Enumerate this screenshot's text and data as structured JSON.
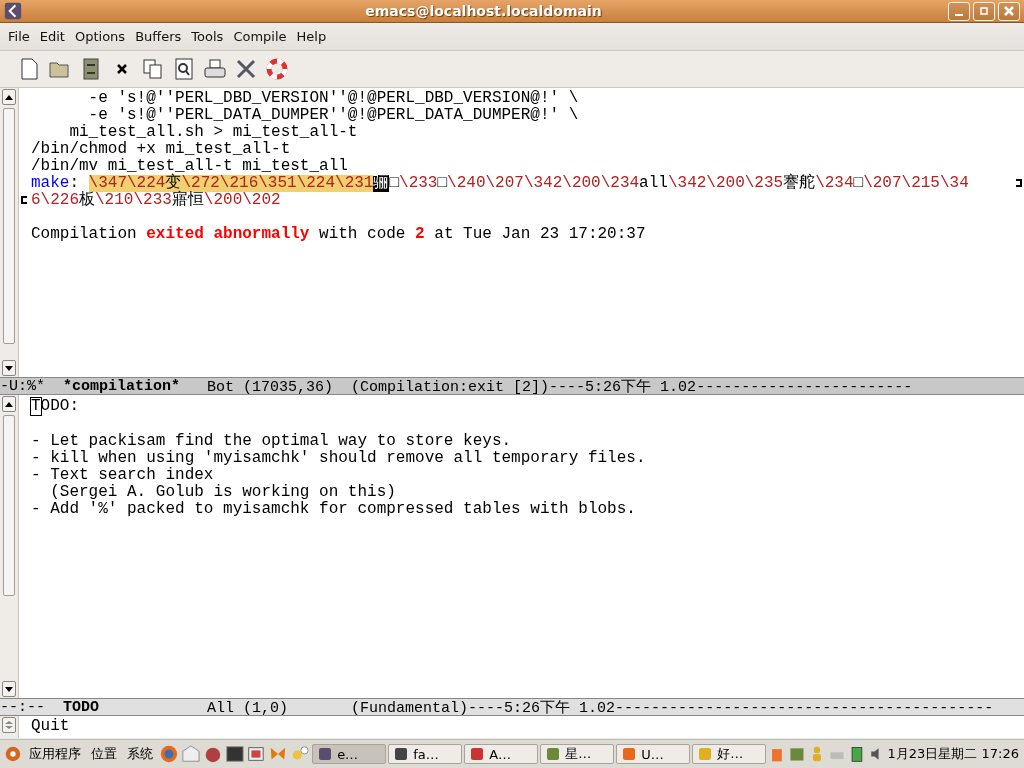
{
  "window": {
    "title": "emacs@localhost.localdomain"
  },
  "menu": [
    {
      "label": "File"
    },
    {
      "label": "Edit"
    },
    {
      "label": "Options"
    },
    {
      "label": "Buffers"
    },
    {
      "label": "Tools"
    },
    {
      "label": "Compile"
    },
    {
      "label": "Help"
    }
  ],
  "top_buffer": {
    "lines": [
      {
        "segments": [
          {
            "kind": "plain",
            "text": "      -e 's!@''PERL_DBD_VERSION''@!@PERL_DBD_VERSION@!' \\"
          }
        ]
      },
      {
        "segments": [
          {
            "kind": "plain",
            "text": "      -e 's!@''PERL_DATA_DUMPER''@!@PERL_DATA_DUMPER@!' \\"
          }
        ]
      },
      {
        "segments": [
          {
            "kind": "plain",
            "text": "    mi_test_all.sh > mi_test_all-t"
          }
        ]
      },
      {
        "segments": [
          {
            "kind": "plain",
            "text": "/bin/chmod +x mi_test_all-t"
          }
        ]
      },
      {
        "segments": [
          {
            "kind": "plain",
            "text": "/bin/mv mi_test_all-t mi_test_all"
          }
        ]
      },
      {
        "wrapped": true,
        "segments": [
          {
            "kind": "builtin",
            "text": "make"
          },
          {
            "kind": "plain",
            "text": ": "
          },
          {
            "kind": "escape_hl",
            "text": "\\347\\224"
          },
          {
            "kind": "plain_hl",
            "text": "变"
          },
          {
            "kind": "escape_hl",
            "text": "\\272\\216\\351\\224\\231"
          },
          {
            "kind": "cursor",
            "text": "骊"
          },
          {
            "kind": "tofu",
            "text": "□"
          },
          {
            "kind": "escape",
            "text": "\\233"
          },
          {
            "kind": "tofu",
            "text": "□"
          },
          {
            "kind": "escape",
            "text": "\\240\\207\\342\\200\\234"
          },
          {
            "kind": "plain",
            "text": "all"
          },
          {
            "kind": "escape",
            "text": "\\342\\200\\235"
          },
          {
            "kind": "plain",
            "text": "謇舵"
          },
          {
            "kind": "escape",
            "text": "\\234"
          },
          {
            "kind": "tofu",
            "text": "□"
          },
          {
            "kind": "escape",
            "text": "\\207\\215\\34"
          }
        ]
      },
      {
        "continued": true,
        "segments": [
          {
            "kind": "escape",
            "text": "6\\226"
          },
          {
            "kind": "plain",
            "text": "板"
          },
          {
            "kind": "escape",
            "text": "\\210\\233"
          },
          {
            "kind": "plain",
            "text": "寤恒"
          },
          {
            "kind": "escape",
            "text": "\\200\\202"
          }
        ]
      },
      {
        "kind": "blank"
      },
      {
        "segments": [
          {
            "kind": "plain",
            "text": "Compilation "
          },
          {
            "kind": "error",
            "text": "exited abnormally"
          },
          {
            "kind": "plain",
            "text": " with code "
          },
          {
            "kind": "error",
            "text": "2"
          },
          {
            "kind": "plain",
            "text": " at Tue Jan 23 17:20:37"
          }
        ]
      }
    ]
  },
  "top_mode_line": {
    "active": true,
    "segments": [
      {
        "bold": false,
        "text": "-U:%*  "
      },
      {
        "bold": true,
        "text": "*compilation*"
      },
      {
        "bold": false,
        "text": "   Bot (17035,36)  (Compilation:exit [2])----5:26下午 1.02------------------------"
      }
    ]
  },
  "bottom_buffer": {
    "lines": [
      {
        "segments": [
          {
            "kind": "box_cursor",
            "text": "T"
          },
          {
            "kind": "plain",
            "text": "ODO:"
          }
        ]
      },
      {
        "kind": "blank"
      },
      {
        "segments": [
          {
            "kind": "plain",
            "text": "- Let packisam find the optimal way to store keys."
          }
        ]
      },
      {
        "segments": [
          {
            "kind": "plain",
            "text": "- kill when using 'myisamchk' should remove all temporary files."
          }
        ]
      },
      {
        "segments": [
          {
            "kind": "plain",
            "text": "- Text search index"
          }
        ]
      },
      {
        "segments": [
          {
            "kind": "plain",
            "text": "  (Sergei A. Golub is working on this)"
          }
        ]
      },
      {
        "segments": [
          {
            "kind": "plain",
            "text": "- Add '%' packed to myisamchk for compressed tables with blobs."
          }
        ]
      }
    ]
  },
  "bottom_mode_line": {
    "active": false,
    "segments": [
      {
        "bold": false,
        "text": "--:--  "
      },
      {
        "bold": true,
        "text": "TODO"
      },
      {
        "bold": false,
        "text": "            All (1,0)       (Fundamental)----5:26下午 1.02------------------------------------------"
      }
    ]
  },
  "minibuffer": {
    "text": "Quit"
  },
  "taskbar": {
    "menus": [
      {
        "label": "应用程序"
      },
      {
        "label": "位置"
      },
      {
        "label": "系统"
      }
    ],
    "tasks": [
      {
        "label": "e…",
        "selected": true
      },
      {
        "label": "fa…",
        "selected": false
      },
      {
        "label": "A…",
        "selected": false
      },
      {
        "label": "星…",
        "selected": false
      },
      {
        "label": "U…",
        "selected": false
      },
      {
        "label": "好…",
        "selected": false
      }
    ],
    "clock": "1月23日星期二 17:26"
  }
}
